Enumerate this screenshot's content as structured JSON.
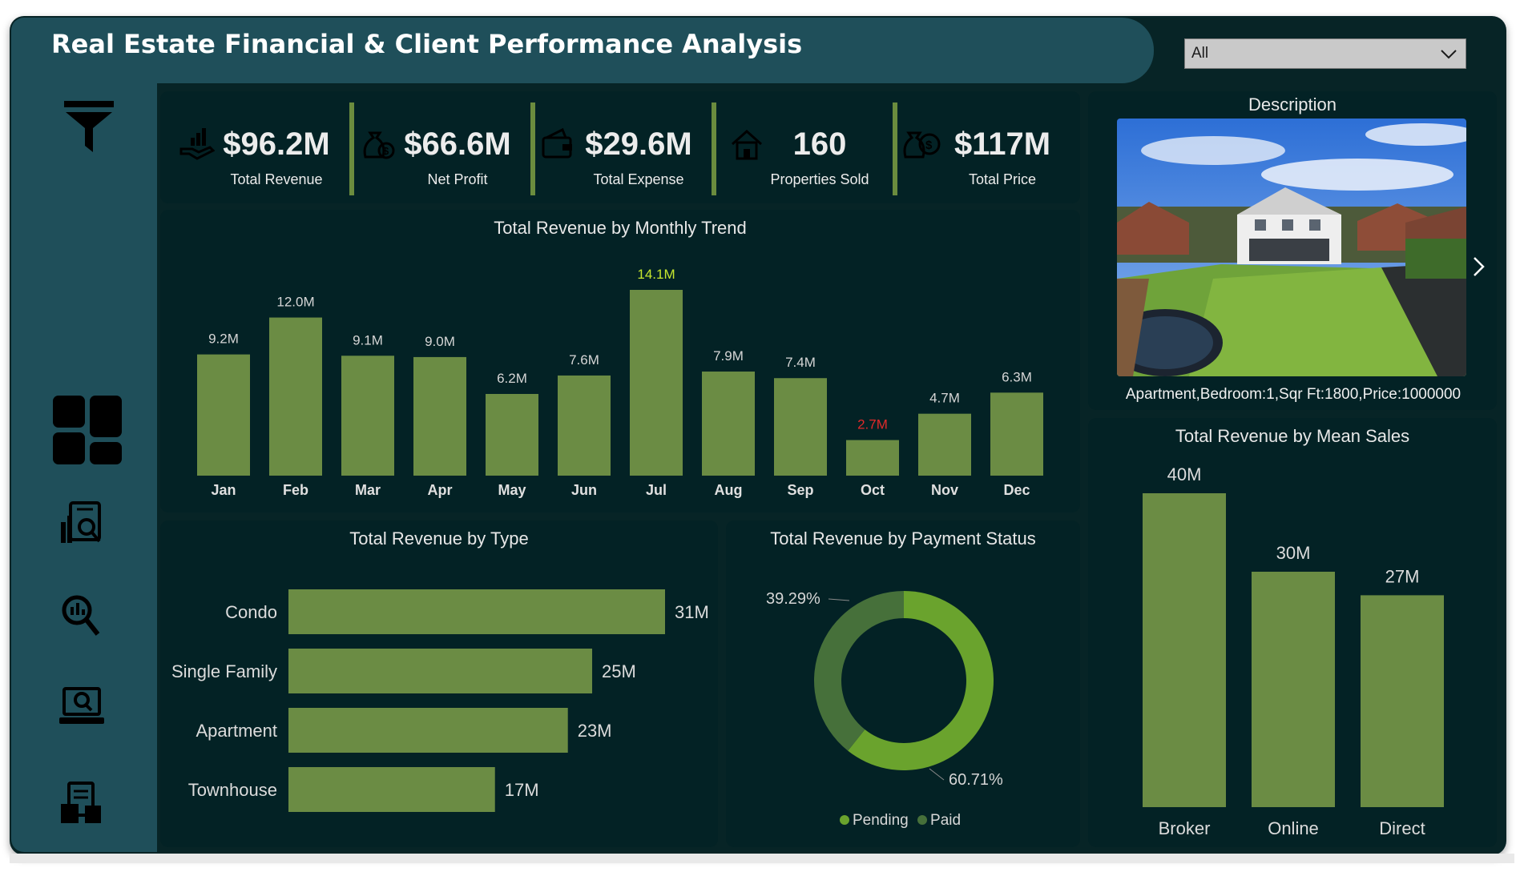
{
  "title": "Real Estate Financial & Client Performance Analysis",
  "filter": {
    "value": "All"
  },
  "sidebar": {
    "items": [
      "filter-icon",
      "dashboard-icon",
      "report-icon",
      "analysis-icon",
      "laptop-analytics-icon",
      "data-icon"
    ]
  },
  "kpis": [
    {
      "value": "$96.2M",
      "label": "Total Revenue",
      "icon": "revenue-hand-icon"
    },
    {
      "value": "$66.6M",
      "label": "Net Profit",
      "icon": "money-bag-icon"
    },
    {
      "value": "$29.6M",
      "label": "Total Expense",
      "icon": "wallet-icon"
    },
    {
      "value": "160",
      "label": "Properties Sold",
      "icon": "house-icon"
    },
    {
      "value": "$117M",
      "label": "Total Price",
      "icon": "price-bag-icon"
    }
  ],
  "description": {
    "title": "Description",
    "caption": "Apartment,Bedroom:1,Sqr Ft:1800,Price:1000000",
    "image": "aerial-house-photo"
  },
  "colors": {
    "bar": "#6b8c44",
    "paid": "#6aa32d",
    "pending": "#46703a",
    "highlight_max": "#c6e62e",
    "highlight_min": "#e02a2a"
  },
  "chart_data": [
    {
      "type": "bar",
      "title": "Total Revenue by Monthly Trend",
      "categories": [
        "Jan",
        "Feb",
        "Mar",
        "Apr",
        "May",
        "Jun",
        "Jul",
        "Aug",
        "Sep",
        "Oct",
        "Nov",
        "Dec"
      ],
      "values": [
        9.2,
        12.0,
        9.1,
        9.0,
        6.2,
        7.6,
        14.1,
        7.9,
        7.4,
        2.7,
        4.7,
        6.3
      ],
      "labels": [
        "9.2M",
        "12.0M",
        "9.1M",
        "9.0M",
        "6.2M",
        "7.6M",
        "14.1M",
        "7.9M",
        "7.4M",
        "2.7M",
        "4.7M",
        "6.3M"
      ],
      "unit": "M",
      "ylim": [
        0,
        14.1
      ]
    },
    {
      "type": "bar",
      "orientation": "horizontal",
      "title": "Total Revenue by Type",
      "categories": [
        "Condo",
        "Single Family",
        "Apartment",
        "Townhouse"
      ],
      "values": [
        31,
        25,
        23,
        17
      ],
      "labels": [
        "31M",
        "25M",
        "23M",
        "17M"
      ],
      "xlim": [
        0,
        31
      ]
    },
    {
      "type": "pie",
      "style": "donut",
      "title": "Total Revenue by Payment Status",
      "categories": [
        "Pending",
        "Paid"
      ],
      "values": [
        39.29,
        60.71
      ],
      "labels": [
        "39.29%",
        "60.71%"
      ],
      "legend": "bottom"
    },
    {
      "type": "bar",
      "title": "Total Revenue by Mean Sales",
      "categories": [
        "Broker",
        "Online",
        "Direct"
      ],
      "values": [
        40,
        30,
        27
      ],
      "labels": [
        "40M",
        "30M",
        "27M"
      ],
      "ylim": [
        0,
        40
      ]
    }
  ]
}
